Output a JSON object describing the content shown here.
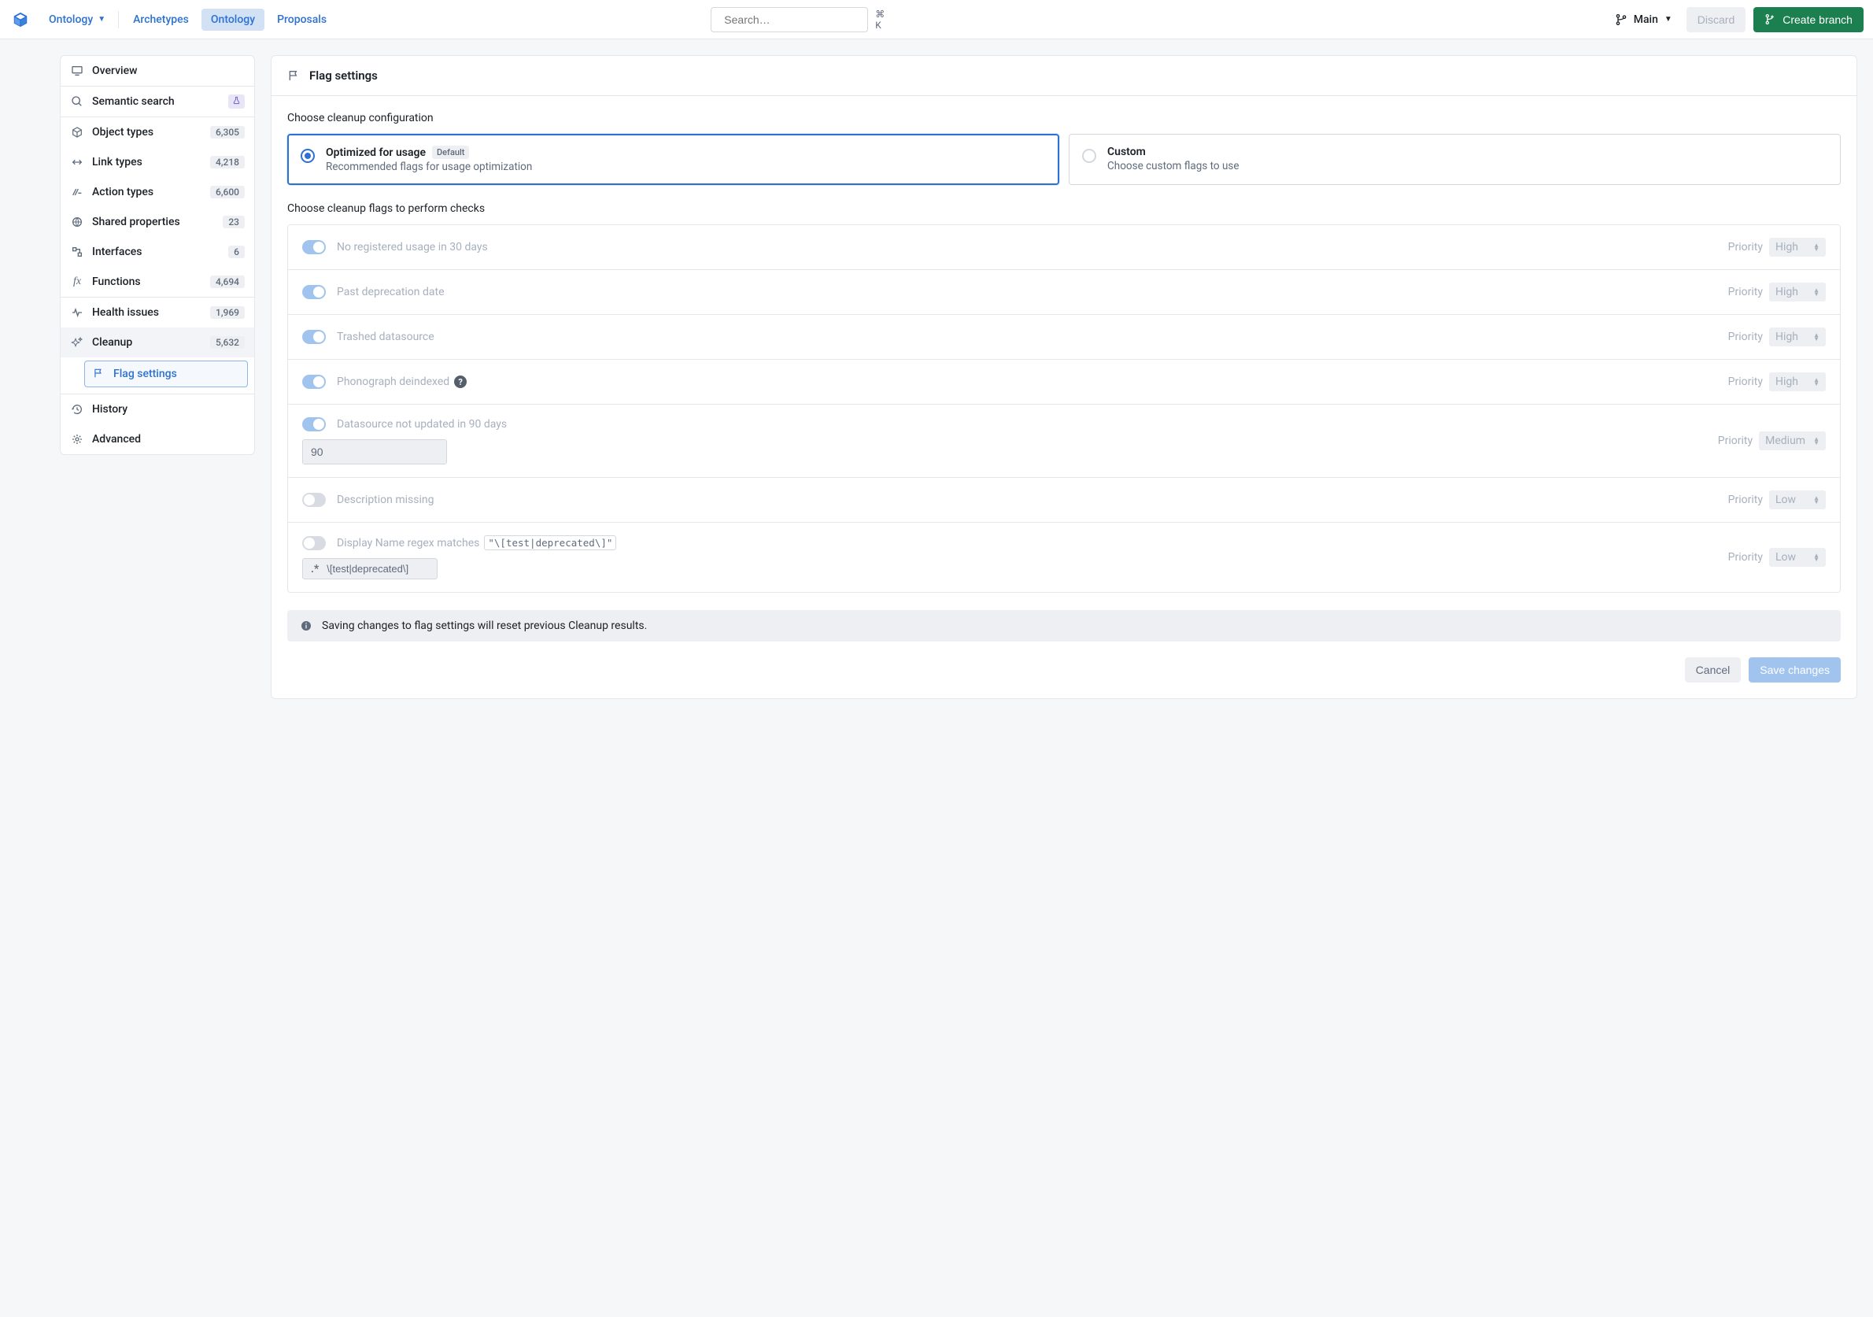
{
  "header": {
    "workspace_label": "Ontology",
    "tabs": [
      {
        "id": "archetypes",
        "label": "Archetypes",
        "active": false
      },
      {
        "id": "ontology",
        "label": "Ontology",
        "active": true
      },
      {
        "id": "proposals",
        "label": "Proposals",
        "active": false
      }
    ],
    "search_placeholder": "Search…",
    "search_shortcut": "⌘ K",
    "branch_label": "Main",
    "discard_label": "Discard",
    "create_branch_label": "Create branch"
  },
  "sidebar": {
    "items": [
      {
        "id": "overview",
        "label": "Overview"
      },
      {
        "id": "semantic-search",
        "label": "Semantic search",
        "badge": "experiment"
      },
      {
        "id": "object-types",
        "label": "Object types",
        "count": "6,305"
      },
      {
        "id": "link-types",
        "label": "Link types",
        "count": "4,218"
      },
      {
        "id": "action-types",
        "label": "Action types",
        "count": "6,600"
      },
      {
        "id": "shared-properties",
        "label": "Shared properties",
        "count": "23"
      },
      {
        "id": "interfaces",
        "label": "Interfaces",
        "count": "6"
      },
      {
        "id": "functions",
        "label": "Functions",
        "count": "4,694"
      },
      {
        "id": "health-issues",
        "label": "Health issues",
        "count": "1,969"
      },
      {
        "id": "cleanup",
        "label": "Cleanup",
        "count": "5,632",
        "active": true
      },
      {
        "id": "history",
        "label": "History"
      },
      {
        "id": "advanced",
        "label": "Advanced"
      }
    ],
    "sub_item": {
      "label": "Flag settings"
    }
  },
  "main": {
    "title": "Flag settings",
    "config_section_label": "Choose cleanup configuration",
    "cards": {
      "optimized": {
        "title": "Optimized for usage",
        "tag": "Default",
        "desc": "Recommended flags for usage optimization"
      },
      "custom": {
        "title": "Custom",
        "desc": "Choose custom flags to use"
      }
    },
    "flags_section_label": "Choose cleanup flags to perform checks",
    "priority_label": "Priority",
    "flags": [
      {
        "id": "no-usage",
        "label": "No registered usage in 30 days",
        "on": true,
        "priority": "High"
      },
      {
        "id": "past-deprecation",
        "label": "Past deprecation date",
        "on": true,
        "priority": "High"
      },
      {
        "id": "trashed-datasource",
        "label": "Trashed datasource",
        "on": true,
        "priority": "High"
      },
      {
        "id": "phono-deindexed",
        "label": "Phonograph deindexed",
        "on": true,
        "priority": "High",
        "help": true
      },
      {
        "id": "not-updated",
        "label": "Datasource not updated in 90 days",
        "on": true,
        "priority": "Medium",
        "input_num": "90"
      },
      {
        "id": "desc-missing",
        "label": "Description missing",
        "on": false,
        "priority": "Low"
      },
      {
        "id": "regex",
        "label": "Display Name regex matches",
        "on": false,
        "priority": "Low",
        "code_tag": "\"\\[test|deprecated\\]\"",
        "input_regex": "\\[test|deprecated\\]"
      }
    ],
    "callout": "Saving changes to flag settings will reset previous Cleanup results.",
    "footer": {
      "cancel": "Cancel",
      "save": "Save changes"
    }
  }
}
